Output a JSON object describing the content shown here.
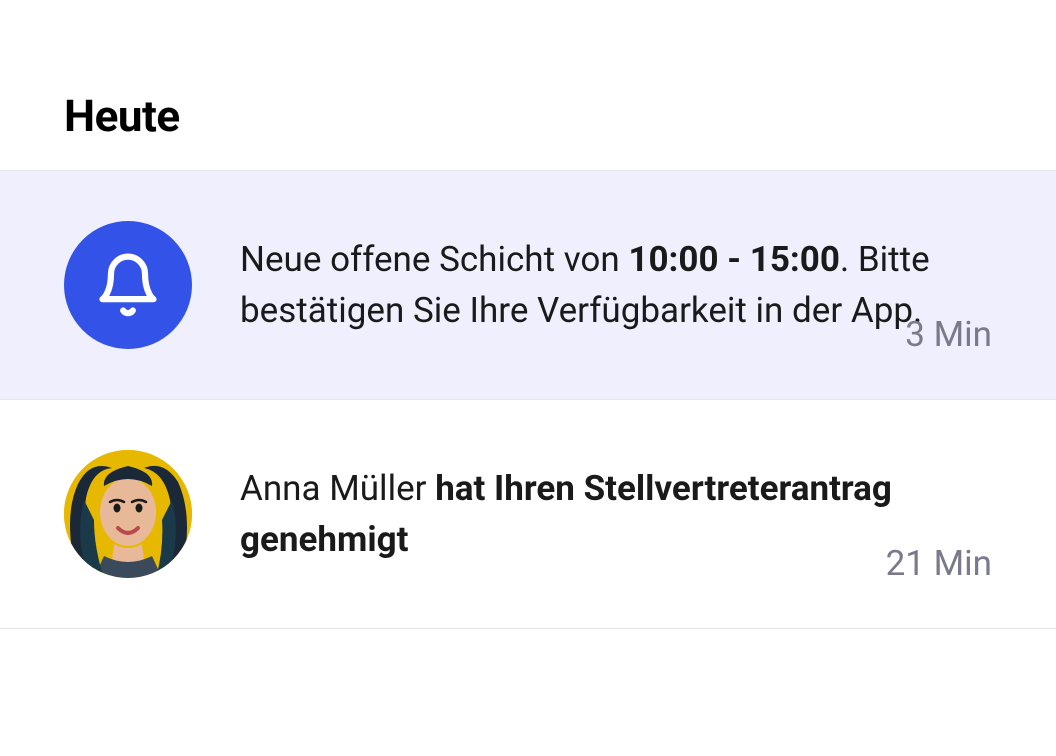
{
  "header": {
    "title": "Heute"
  },
  "notifications": [
    {
      "icon": "bell",
      "highlighted": true,
      "text_prefix": "Neue offene Schicht von ",
      "text_bold": "10:00 - 15:00",
      "text_suffix": ". Bitte bestätigen Sie Ihre Verfügbarkeit in der App.",
      "time": "3 Min"
    },
    {
      "icon": "avatar",
      "highlighted": false,
      "text_prefix": "Anna Müller ",
      "text_bold": "hat Ihren Stellvertreterantrag genehmigt",
      "text_suffix": "",
      "time": "21 Min"
    }
  ]
}
